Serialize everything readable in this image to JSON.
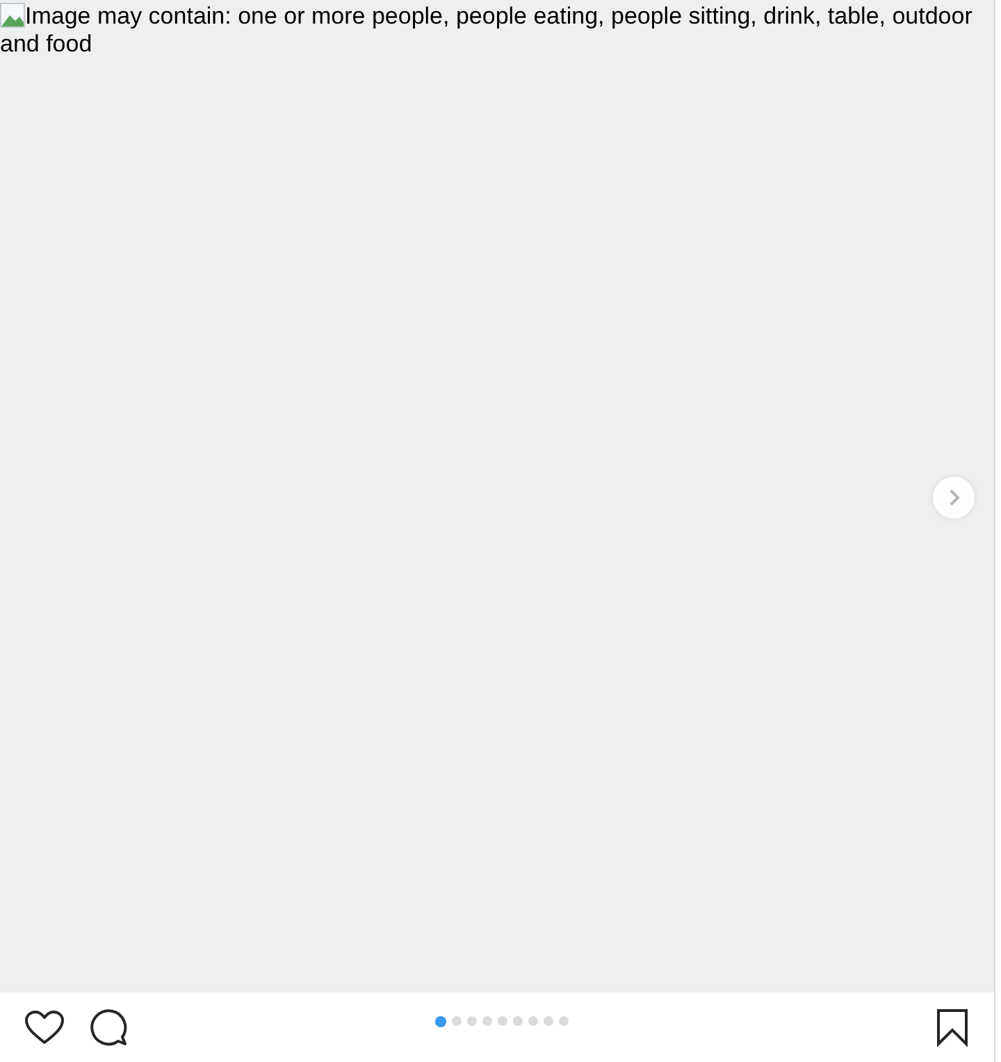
{
  "post": {
    "image_alt": "Image may contain: one or more people, people eating, people sitting, drink, table, outdoor and food"
  },
  "carousel": {
    "dots": [
      {
        "selected": true
      },
      {
        "selected": false
      },
      {
        "selected": false
      },
      {
        "selected": false
      },
      {
        "selected": false
      },
      {
        "selected": false
      },
      {
        "selected": false
      },
      {
        "selected": false
      },
      {
        "selected": false
      }
    ]
  }
}
